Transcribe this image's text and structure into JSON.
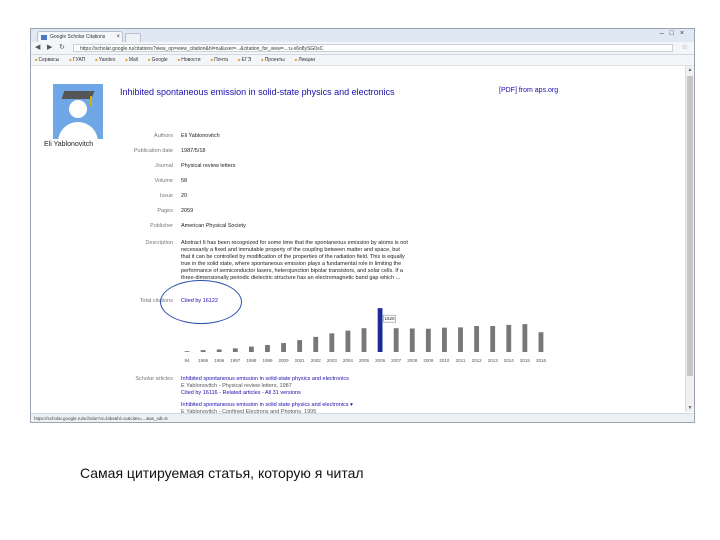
{
  "browser": {
    "tab_title": "Google Scholar Citations",
    "url": "https://scholar.google.ru/citations?view_op=view_citation&hl=ru&user=...&citation_for_view=...:u-x6o8ySG0sC",
    "bookmarks": [
      "Сервисы",
      "ГУАП",
      "Yandex",
      "Mail",
      "Google",
      "Новости",
      "Почта",
      "ЕГЭ",
      "Проекты",
      "Лекции"
    ]
  },
  "profile": {
    "name": "Eli Yablonovitch"
  },
  "article": {
    "title": "Inhibited spontaneous emission in solid-state physics and electronics",
    "pdf_link": "[PDF] from aps.org",
    "fields": [
      {
        "label": "Authors",
        "value": "Eli Yablonovitch"
      },
      {
        "label": "Publication date",
        "value": "1987/5/18"
      },
      {
        "label": "Journal",
        "value": "Physical review letters"
      },
      {
        "label": "Volume",
        "value": "58"
      },
      {
        "label": "Issue",
        "value": "20"
      },
      {
        "label": "Pages",
        "value": "2059"
      },
      {
        "label": "Publisher",
        "value": "American Physical Society"
      }
    ],
    "description_label": "Description",
    "description_lines": [
      "Abstract It has been recognized for some time that the spontaneous emission by atoms is not",
      "necessarily a fixed and immutable property of the coupling between matter and space, but",
      "that it can be controlled by modification of the properties of the radiation field. This is equally",
      "true in the solid state, where spontaneous emission plays a fundamental role in limiting the",
      "performance of semiconductor lasers, heterojunction bipolar transistors, and solar cells. If a",
      "three-dimensionally periodic dielectric structure has an electromagnetic band gap which ..."
    ],
    "citations_label": "Total citations",
    "citations_value": "Cited by 16122",
    "scholar_label": "Scholar articles",
    "scholar_articles": [
      {
        "title": "Inhibited spontaneous emission in solid-state physics and electronics",
        "authors": "E Yablonovitch - Physical review letters, 1987",
        "links": "Cited by 16116 - Related articles - All 31 versions"
      },
      {
        "title": "Inhibited spontaneous emission in solid state physics and electronics ▾",
        "authors": "E Yablonovitch - Confined Electrons and Photons, 1995",
        "links": "Cited by 3 - Related articles"
      }
    ]
  },
  "status_url": "https://scholar.google.ru/scholar?oi=bibs&hl=ru&cites=...&as_sdt=5",
  "caption": "Самая цитируемая статья, которую я читал",
  "chart_data": {
    "type": "bar",
    "categories": [
      "94",
      "1995",
      "1996",
      "1997",
      "1998",
      "1999",
      "2000",
      "2001",
      "2002",
      "2003",
      "2004",
      "2005",
      "2006",
      "2007",
      "2008",
      "2009",
      "2010",
      "2011",
      "2012",
      "2013",
      "2014",
      "2015",
      "2016"
    ],
    "values": [
      30,
      70,
      95,
      135,
      200,
      260,
      330,
      440,
      560,
      690,
      790,
      880,
      1620,
      880,
      870,
      860,
      900,
      910,
      960,
      960,
      1000,
      1030,
      730
    ],
    "highlight_index": 12,
    "highlight_label": "1620",
    "bar_color": "#777777",
    "highlight_color": "#1e2a9a",
    "ylim": [
      0,
      1700
    ]
  }
}
